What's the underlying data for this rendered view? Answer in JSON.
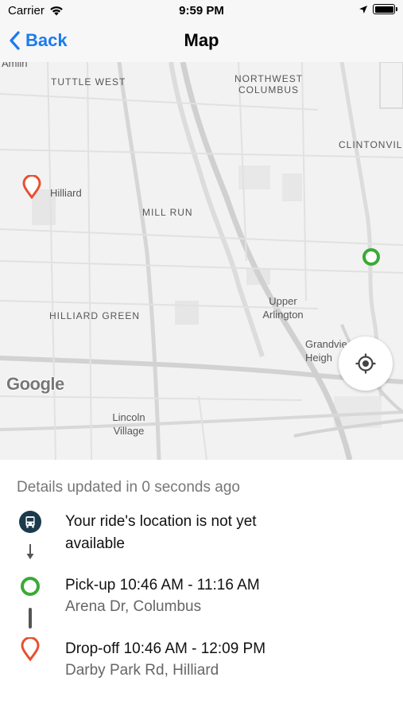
{
  "status_bar": {
    "carrier": "Carrier",
    "time": "9:59 PM"
  },
  "nav": {
    "back_label": "Back",
    "title": "Map"
  },
  "map": {
    "labels": {
      "amlin": "Amlin",
      "tuttle_west": "TUTTLE WEST",
      "northwest_columbus_1": "NORTHWEST",
      "northwest_columbus_2": "COLUMBUS",
      "clintonville": "CLINTONVIL",
      "hilliard": "Hilliard",
      "mill_run": "MILL RUN",
      "upper_arlington_1": "Upper",
      "upper_arlington_2": "Arlington",
      "hilliard_green": "HILLIARD GREEN",
      "grandview_1": "Grandvie",
      "grandview_2": "Heigh",
      "lincoln_village_1": "Lincoln",
      "lincoln_village_2": "Village"
    },
    "attribution": "Google",
    "colors": {
      "pickup_pin": "#3aaa35",
      "dropoff_pin": "#e8502f"
    }
  },
  "details": {
    "updated_text": "Details updated in 0 seconds ago",
    "ride_status_line1": "Your ride's location is not yet",
    "ride_status_line2": "available",
    "pickup_title": "Pick-up 10:46 AM - 11:16 AM",
    "pickup_address": "Arena Dr, Columbus",
    "dropoff_title": "Drop-off 10:46 AM - 12:09 PM",
    "dropoff_address": "Darby Park Rd, Hilliard",
    "icons": {
      "bus": "bus-icon",
      "pickup": "pickup-circle-icon",
      "dropoff": "dropoff-pin-icon"
    }
  }
}
